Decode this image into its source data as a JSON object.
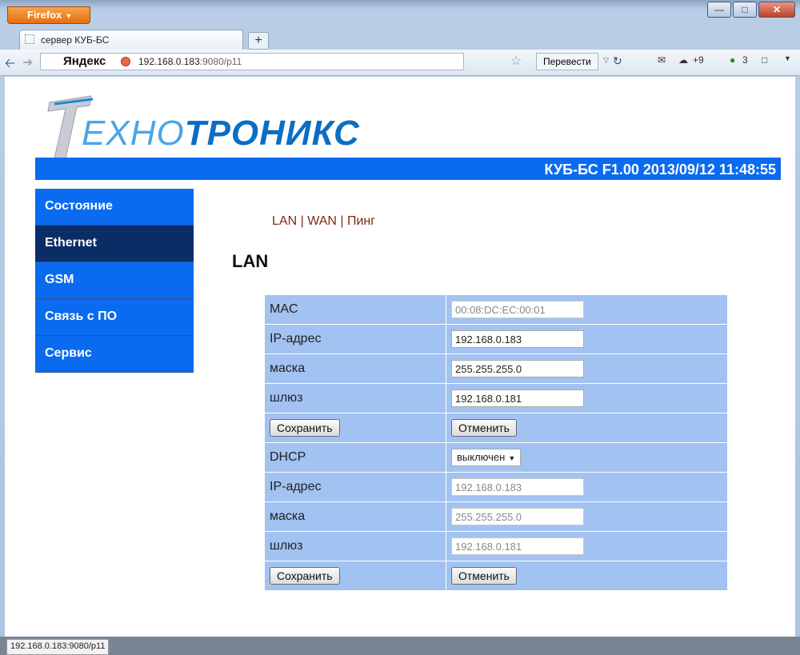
{
  "browser": {
    "app_button": "Firefox",
    "tab_title": "сервер КУБ-БС",
    "new_tab": "+",
    "search_brand": "Яндекс",
    "url_host": "192.168.0.183",
    "url_rest": ":9080/p11",
    "translate_label": "Перевести",
    "weather": "+9",
    "ext_count": "3",
    "status_url": "192.168.0.183:9080/p11"
  },
  "page": {
    "logo_light": "ЕХНО",
    "logo_bold": "ТРОНИКС",
    "header_info": "КУБ-БС F1.00 2013/09/12 11:48:55",
    "menu": [
      {
        "label": "Состояние"
      },
      {
        "label": "Ethernet"
      },
      {
        "label": "GSM"
      },
      {
        "label": "Связь с ПО"
      },
      {
        "label": "Сервис"
      }
    ],
    "subnav": {
      "lan": "LAN",
      "wan": "WAN",
      "ping": "Пинг",
      "sep": "|"
    },
    "title": "LAN",
    "static": {
      "mac_label": "MAC",
      "mac_value": "00:08:DC:EC:00:01",
      "ip_label": "IP-адрес",
      "ip_value": "192.168.0.183",
      "mask_label": "маска",
      "mask_value": "255.255.255.0",
      "gw_label": "шлюз",
      "gw_value": "192.168.0.181",
      "save": "Сохранить",
      "cancel": "Отменить"
    },
    "dhcp": {
      "label": "DHCP",
      "state": "выключен",
      "ip_label": "IP-адрес",
      "ip_value": "192.168.0.183",
      "mask_label": "маска",
      "mask_value": "255.255.255.0",
      "gw_label": "шлюз",
      "gw_value": "192.168.0.181",
      "save": "Сохранить",
      "cancel": "Отменить"
    }
  },
  "colors": {
    "accent": "#0a6bf0",
    "menu_active": "#0b2d66",
    "table_bg": "#a2c2f2"
  }
}
